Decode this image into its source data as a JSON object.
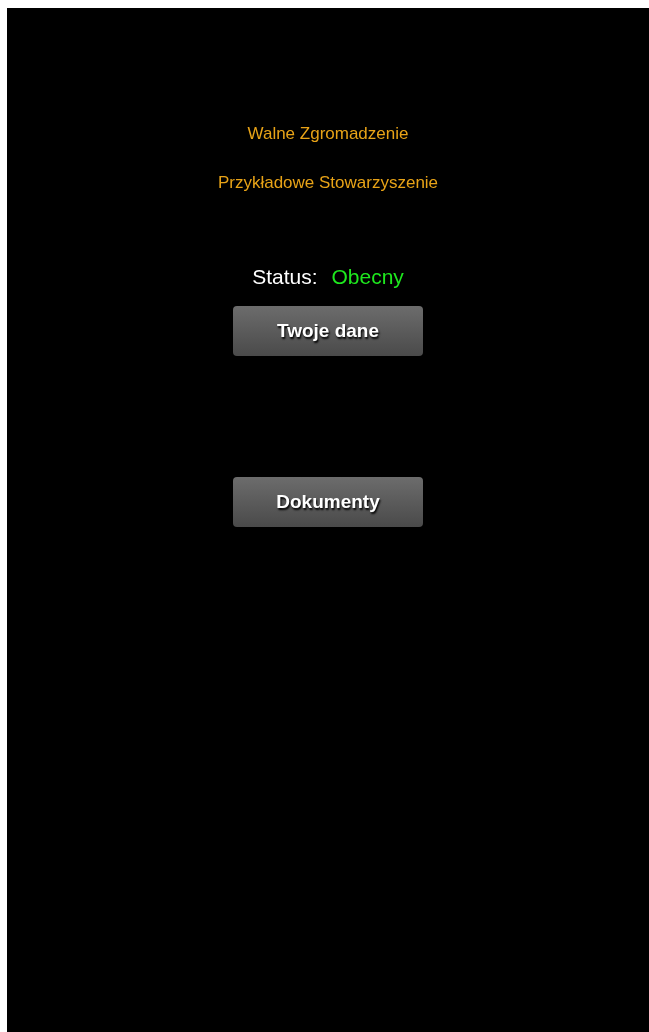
{
  "header": {
    "title": "Walne Zgromadzenie",
    "organization": "Przykładowe Stowarzyszenie"
  },
  "status": {
    "label": "Status:",
    "value": "Obecny"
  },
  "buttons": [
    {
      "label": "Twoje dane"
    },
    {
      "label": "Dokumenty"
    }
  ]
}
